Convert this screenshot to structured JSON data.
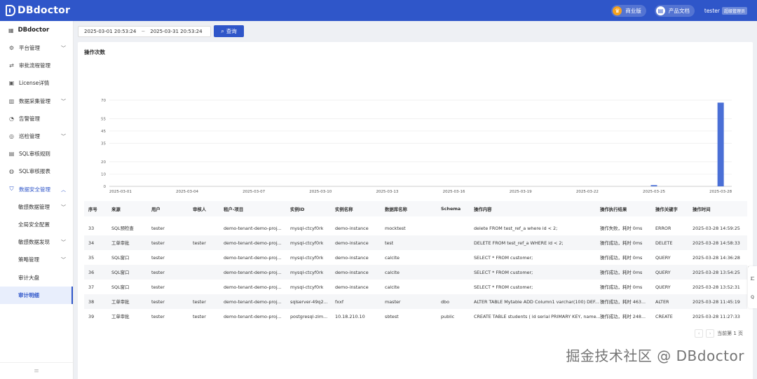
{
  "app": {
    "title": "DBdoctor",
    "edition_label": "商业版",
    "docs_label": "产品文档",
    "user": "tester",
    "role": "超级管理员"
  },
  "sidebar": {
    "header": "DBdoctor",
    "items": [
      {
        "label": "平台管理",
        "icon": "gear-icon",
        "expandable": true
      },
      {
        "label": "审批流程管理",
        "icon": "flow-icon",
        "expandable": false
      },
      {
        "label": "License详情",
        "icon": "license-icon",
        "expandable": false
      },
      {
        "label": "数据采集管理",
        "icon": "collect-icon",
        "expandable": true
      },
      {
        "label": "告警管理",
        "icon": "bell-icon",
        "expandable": false
      },
      {
        "label": "巡检管理",
        "icon": "inspect-icon",
        "expandable": true
      },
      {
        "label": "SQL审核规则",
        "icon": "rule-icon",
        "expandable": false
      },
      {
        "label": "SQL审核报表",
        "icon": "report-icon",
        "expandable": false
      },
      {
        "label": "数据安全管理",
        "icon": "shield-icon",
        "expandable": true,
        "expanded": true
      }
    ],
    "sub_items": [
      {
        "label": "敏感数据管理",
        "expandable": true
      },
      {
        "label": "全局安全配置",
        "expandable": false
      },
      {
        "label": "敏感数据发现",
        "expandable": true
      },
      {
        "label": "策略管理",
        "expandable": true
      },
      {
        "label": "审计大盘",
        "expandable": false
      },
      {
        "label": "审计明细",
        "expandable": false,
        "selected": true
      }
    ]
  },
  "filter": {
    "start": "2025-03-01 20:53:24",
    "end": "2025-03-31 20:53:24",
    "separator": "~",
    "query_label": "查询"
  },
  "chart_data": {
    "type": "bar",
    "title": "操作次数",
    "x": [
      "2025-03-01",
      "2025-03-02",
      "2025-03-03",
      "2025-03-04",
      "2025-03-05",
      "2025-03-06",
      "2025-03-07",
      "2025-03-08",
      "2025-03-09",
      "2025-03-10",
      "2025-03-11",
      "2025-03-12",
      "2025-03-13",
      "2025-03-14",
      "2025-03-15",
      "2025-03-16",
      "2025-03-17",
      "2025-03-18",
      "2025-03-19",
      "2025-03-20",
      "2025-03-21",
      "2025-03-22",
      "2025-03-23",
      "2025-03-24",
      "2025-03-25",
      "2025-03-26",
      "2025-03-27",
      "2025-03-28"
    ],
    "x_tick_labels": [
      "2025-03-01",
      "2025-03-04",
      "2025-03-07",
      "2025-03-10",
      "2025-03-13",
      "2025-03-16",
      "2025-03-19",
      "2025-03-22",
      "2025-03-25",
      "2025-03-28"
    ],
    "values": [
      0,
      0,
      0,
      0,
      0,
      0,
      0,
      0,
      0,
      0,
      0,
      0,
      0,
      0,
      0,
      0,
      0,
      0,
      0,
      0,
      0,
      0,
      0,
      0,
      1,
      0,
      0,
      68
    ],
    "y_ticks": [
      0,
      10,
      20,
      35,
      45,
      55,
      70
    ],
    "ylim": [
      0,
      70
    ],
    "grid": true,
    "color": "#4a6fd6"
  },
  "table": {
    "columns": [
      "序号",
      "来源",
      "用户",
      "审核人",
      "租户-项目",
      "实例ID",
      "实例名称",
      "数据库名称",
      "Schema",
      "操作内容",
      "操作执行结果",
      "操作关键字",
      "操作时间"
    ],
    "rows": [
      [
        "33",
        "SQL预检查",
        "tester",
        "",
        "demo-tenant-demo-proj...",
        "mysql-ctcyf0rk",
        "demo-instance",
        "mocktest",
        "",
        "delete FROM test_ref_a where id < 2;",
        "操作失败，耗时 0ms",
        "ERROR",
        "2025-03-28 14:59:25"
      ],
      [
        "34",
        "工单审批",
        "tester",
        "tester",
        "demo-tenant-demo-proj...",
        "mysql-ctcyf0rk",
        "demo-instance",
        "test",
        "",
        "DELETE FROM test_ref_a WHERE id < 2;",
        "操作成功，耗时 0ms",
        "DELETE",
        "2025-03-28 14:58:33"
      ],
      [
        "35",
        "SQL窗口",
        "tester",
        "",
        "demo-tenant-demo-proj...",
        "mysql-ctcyf0rk",
        "demo-instance",
        "calcite",
        "",
        "SELECT * FROM customer;",
        "操作成功，耗时 0ms",
        "QUERY",
        "2025-03-28 14:36:28"
      ],
      [
        "36",
        "SQL窗口",
        "tester",
        "",
        "demo-tenant-demo-proj...",
        "mysql-ctcyf0rk",
        "demo-instance",
        "calcite",
        "",
        "SELECT * FROM customer;",
        "操作成功，耗时 0ms",
        "QUERY",
        "2025-03-28 13:54:25"
      ],
      [
        "37",
        "SQL窗口",
        "tester",
        "",
        "demo-tenant-demo-proj...",
        "mysql-ctcyf0rk",
        "demo-instance",
        "calcite",
        "",
        "SELECT * FROM customer;",
        "操作成功，耗时 0ms",
        "QUERY",
        "2025-03-28 13:52:31"
      ],
      [
        "38",
        "工单审批",
        "tester",
        "tester",
        "demo-tenant-demo-proj...",
        "sqlserver-49q2...",
        "fxxf",
        "master",
        "dbo",
        "ALTER TABLE Mytable ADD Column1 varchar(100) DEF...",
        "操作成功，耗时 463...",
        "ALTER",
        "2025-03-28 11:45:19"
      ],
      [
        "39",
        "工单审批",
        "tester",
        "tester",
        "demo-tenant-demo-proj...",
        "postgresql-zim...",
        "10.18.210.10",
        "sbtest",
        "public",
        "CREATE TABLE students ( id serial PRIMARY KEY, name...",
        "操作成功，耗时 248...",
        "CREATE",
        "2025-03-28 11:27:33"
      ]
    ]
  },
  "pager": {
    "current_label": "当前第 1 页"
  },
  "float_tool": {
    "item1": "汇",
    "item2": "Q"
  },
  "watermark": "掘金技术社区 @ DBdoctor"
}
